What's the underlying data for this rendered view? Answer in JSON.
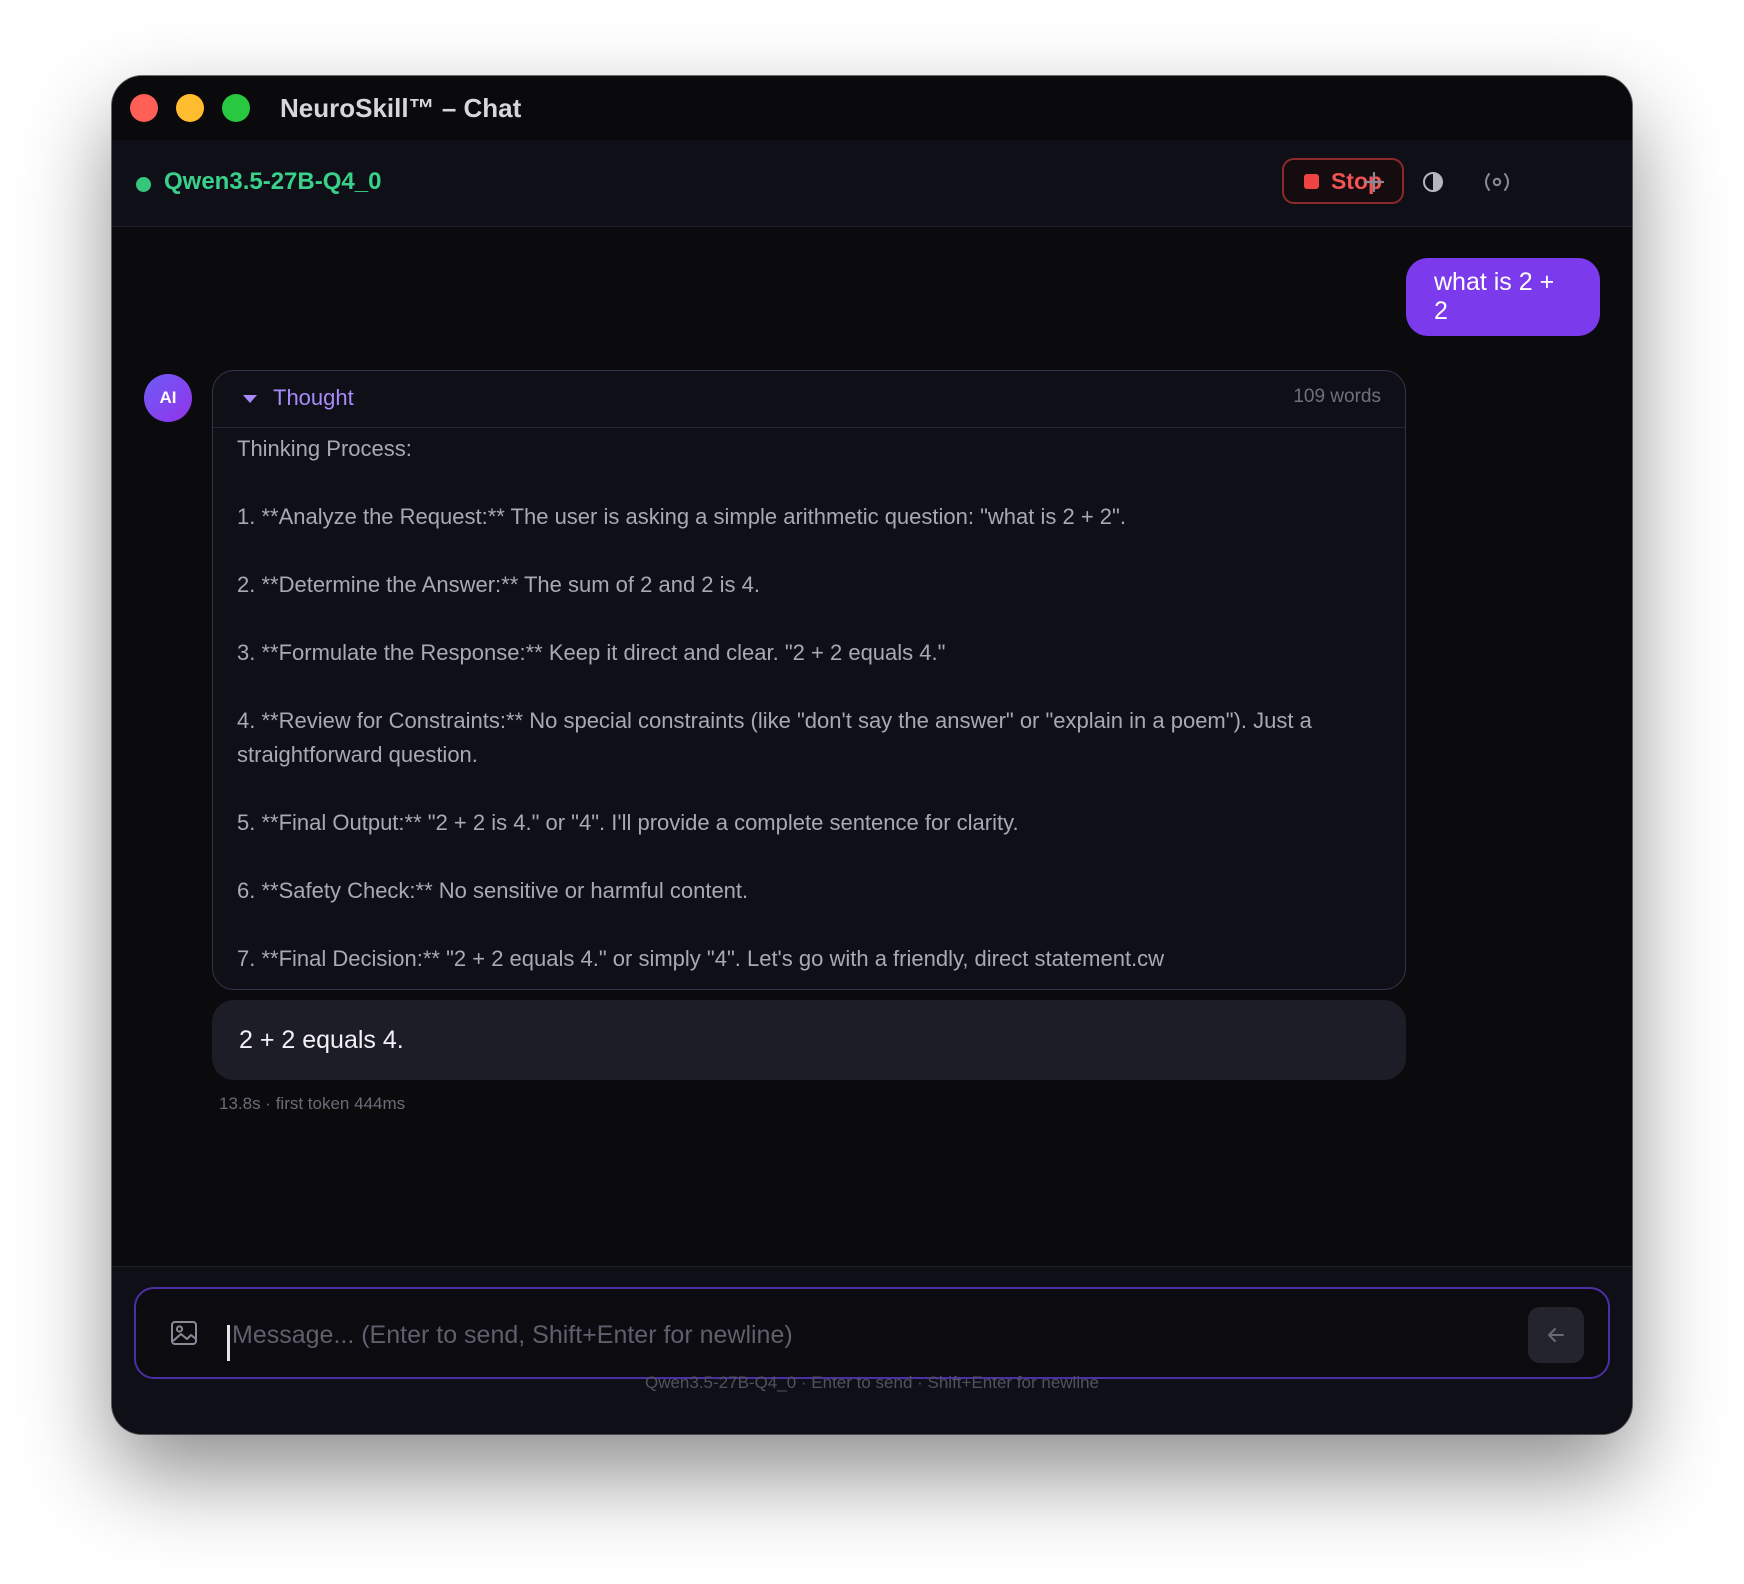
{
  "window": {
    "title": "NeuroSkill™ – Chat"
  },
  "header": {
    "model_name": "Qwen3.5-27B-Q4_0",
    "model_status_color": "#34c77b",
    "stop_label": "Stop",
    "icons": [
      "plus-icon",
      "contrast-icon",
      "broadcast-icon"
    ]
  },
  "messages": {
    "user": {
      "text": "what is 2 + 2"
    },
    "assistant": {
      "avatar_label": "AI",
      "thought": {
        "label": "Thought",
        "word_count": "109 words",
        "lines": [
          "Thinking Process:",
          "1.  **Analyze the Request:** The user is asking a simple arithmetic question: \"what is 2 + 2\".",
          "2.  **Determine the Answer:** The sum of 2 and 2 is 4.",
          "3.  **Formulate the Response:** Keep it direct and clear. \"2 + 2 equals 4.\"",
          "4.  **Review for Constraints:** No special constraints (like \"don't say the answer\" or \"explain in a poem\"). Just a straightforward question.",
          "5.  **Final Output:** \"2 + 2 is 4.\" or \"4\". I'll provide a complete sentence for clarity.",
          "6.  **Safety Check:** No sensitive or harmful content.",
          "7.  **Final Decision:** \"2 + 2 equals 4.\" or simply \"4\". Let's go with a friendly, direct statement.cw"
        ]
      },
      "answer": "2 + 2 equals 4.",
      "meta": "13.8s · first token 444ms"
    }
  },
  "composer": {
    "placeholder": "Message... (Enter to send, Shift+Enter for newline)",
    "value": "",
    "footer_hint": "Qwen3.5-27B-Q4_0 · Enter to send · Shift+Enter for newline"
  },
  "colors": {
    "accent": "#7c3aed",
    "thought_label": "#a78bfa",
    "stop": "#ef4444",
    "background": "#0b0b0d"
  }
}
